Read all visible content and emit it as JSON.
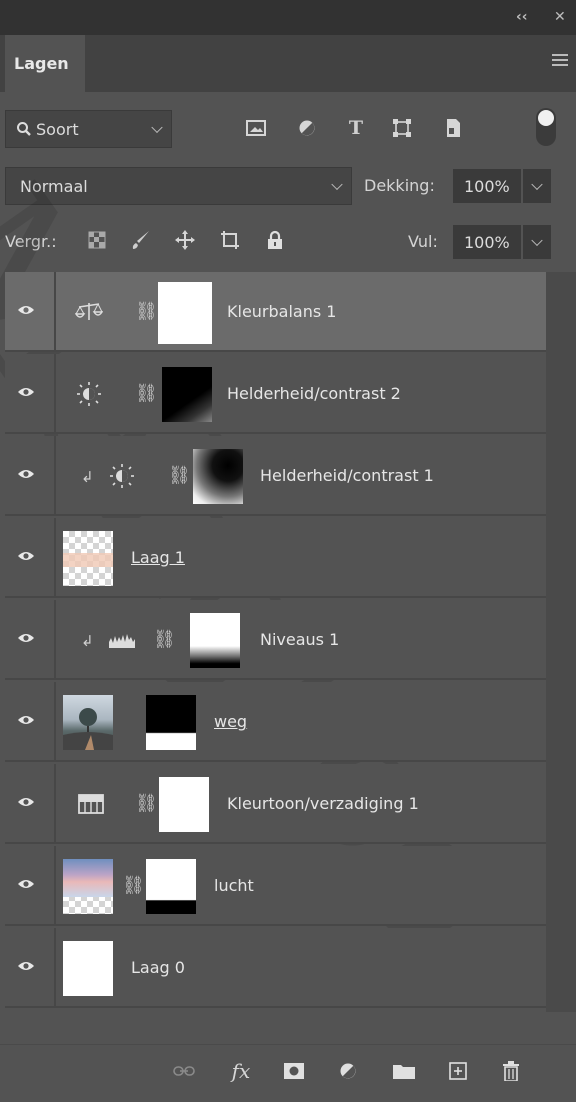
{
  "panel": {
    "tab_label": "Lagen",
    "collapse_glyph": "‹‹",
    "close_glyph": "✕"
  },
  "filter": {
    "kind_label": "Soort",
    "icons": [
      "image-filter-icon",
      "adjustment-filter-icon",
      "type-filter-icon",
      "shape-filter-icon",
      "smart-object-filter-icon"
    ]
  },
  "blend": {
    "mode": "Normaal",
    "opacity_label": "Dekking:",
    "opacity_value": "100%"
  },
  "locks": {
    "label": "Vergr.:",
    "fill_label": "Vul:",
    "fill_value": "100%"
  },
  "layers": [
    {
      "name": "Kleurbalans 1",
      "kind": "color-balance",
      "selected": true,
      "mask": "white"
    },
    {
      "name": "Helderheid/contrast 2",
      "kind": "brightness-contrast",
      "mask": "dark"
    },
    {
      "name": "Helderheid/contrast 1",
      "kind": "brightness-contrast",
      "clipped": true,
      "mask": "radial"
    },
    {
      "name": "Laag 1",
      "kind": "pixel",
      "underlined": true
    },
    {
      "name": "Niveaus 1",
      "kind": "levels",
      "clipped": true,
      "mask": "white-bottom-dark"
    },
    {
      "name": "weg",
      "kind": "pixel-masked",
      "underlined": true
    },
    {
      "name": "Kleurtoon/verzadiging 1",
      "kind": "hue-saturation",
      "mask": "white"
    },
    {
      "name": "lucht",
      "kind": "pixel-masked"
    },
    {
      "name": "Laag 0",
      "kind": "pixel"
    }
  ],
  "watermark": "Maligroo",
  "bottom_icons": [
    "link-layers-icon",
    "fx-icon",
    "add-mask-icon",
    "new-adjustment-icon",
    "new-group-icon",
    "new-layer-icon",
    "delete-layer-icon"
  ]
}
